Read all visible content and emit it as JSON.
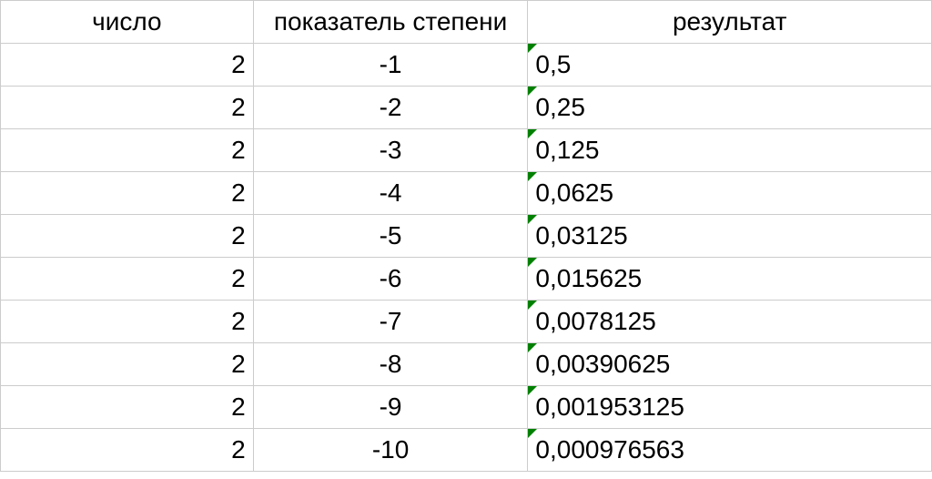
{
  "table": {
    "headers": {
      "number": "число",
      "exponent": "показатель степени",
      "result": "результат"
    },
    "rows": [
      {
        "number": "2",
        "exponent": "-1",
        "result": "0,5"
      },
      {
        "number": "2",
        "exponent": "-2",
        "result": "0,25"
      },
      {
        "number": "2",
        "exponent": "-3",
        "result": "0,125"
      },
      {
        "number": "2",
        "exponent": "-4",
        "result": "0,0625"
      },
      {
        "number": "2",
        "exponent": "-5",
        "result": "0,03125"
      },
      {
        "number": "2",
        "exponent": "-6",
        "result": "0,015625"
      },
      {
        "number": "2",
        "exponent": "-7",
        "result": "0,0078125"
      },
      {
        "number": "2",
        "exponent": "-8",
        "result": "0,00390625"
      },
      {
        "number": "2",
        "exponent": "-9",
        "result": "0,001953125"
      },
      {
        "number": "2",
        "exponent": "-10",
        "result": "0,000976563"
      }
    ]
  }
}
